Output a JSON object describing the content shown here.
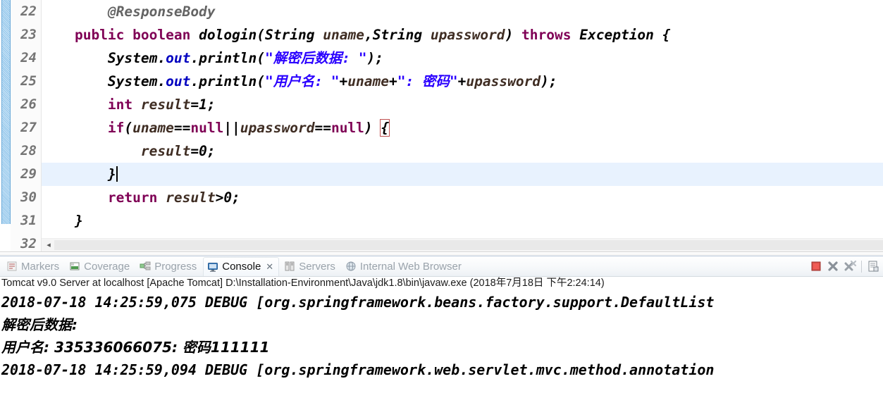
{
  "editor": {
    "lines": [
      {
        "number": "22",
        "tokens": [
          {
            "t": "        ",
            "c": "punc"
          },
          {
            "t": "@ResponseBody",
            "c": "ann"
          }
        ]
      },
      {
        "number": "23",
        "tokens": [
          {
            "t": "    ",
            "c": "punc"
          },
          {
            "t": "public",
            "c": "kw"
          },
          {
            "t": " ",
            "c": "punc"
          },
          {
            "t": "boolean",
            "c": "kw"
          },
          {
            "t": " ",
            "c": "punc"
          },
          {
            "t": "dologin(",
            "c": "mth"
          },
          {
            "t": "String",
            "c": "type"
          },
          {
            "t": " ",
            "c": "punc"
          },
          {
            "t": "uname",
            "c": "var"
          },
          {
            "t": ",",
            "c": "plain"
          },
          {
            "t": "String",
            "c": "type"
          },
          {
            "t": " ",
            "c": "punc"
          },
          {
            "t": "upassword",
            "c": "var"
          },
          {
            "t": ") ",
            "c": "plain"
          },
          {
            "t": "throws",
            "c": "kw"
          },
          {
            "t": " ",
            "c": "punc"
          },
          {
            "t": "Exception {",
            "c": "type"
          }
        ]
      },
      {
        "number": "24",
        "tokens": [
          {
            "t": "        ",
            "c": "punc"
          },
          {
            "t": "System",
            "c": "plain"
          },
          {
            "t": ".",
            "c": "plain"
          },
          {
            "t": "out",
            "c": "fld"
          },
          {
            "t": ".println(",
            "c": "plain"
          },
          {
            "t": "\"解密后数据: \"",
            "c": "str"
          },
          {
            "t": ");",
            "c": "plain"
          }
        ]
      },
      {
        "number": "25",
        "tokens": [
          {
            "t": "        ",
            "c": "punc"
          },
          {
            "t": "System",
            "c": "plain"
          },
          {
            "t": ".",
            "c": "plain"
          },
          {
            "t": "out",
            "c": "fld"
          },
          {
            "t": ".println(",
            "c": "plain"
          },
          {
            "t": "\"用户名: \"",
            "c": "str"
          },
          {
            "t": "+",
            "c": "plain"
          },
          {
            "t": "uname",
            "c": "var"
          },
          {
            "t": "+",
            "c": "plain"
          },
          {
            "t": "\": 密码\"",
            "c": "str"
          },
          {
            "t": "+",
            "c": "plain"
          },
          {
            "t": "upassword",
            "c": "var"
          },
          {
            "t": ");",
            "c": "plain"
          }
        ]
      },
      {
        "number": "26",
        "tokens": [
          {
            "t": "        ",
            "c": "punc"
          },
          {
            "t": "int",
            "c": "kw"
          },
          {
            "t": " ",
            "c": "punc"
          },
          {
            "t": "result",
            "c": "var"
          },
          {
            "t": "=1;",
            "c": "plain"
          }
        ]
      },
      {
        "number": "27",
        "tokens": [
          {
            "t": "        ",
            "c": "punc"
          },
          {
            "t": "if",
            "c": "kw"
          },
          {
            "t": "(",
            "c": "plain"
          },
          {
            "t": "uname",
            "c": "var"
          },
          {
            "t": "==",
            "c": "plain"
          },
          {
            "t": "null",
            "c": "kw"
          },
          {
            "t": "||",
            "c": "plain"
          },
          {
            "t": "upassword",
            "c": "var"
          },
          {
            "t": "==",
            "c": "plain"
          },
          {
            "t": "null",
            "c": "kw"
          },
          {
            "t": ") ",
            "c": "plain"
          },
          {
            "t": "{",
            "c": "brace"
          }
        ]
      },
      {
        "number": "28",
        "tokens": [
          {
            "t": "            ",
            "c": "punc"
          },
          {
            "t": "result",
            "c": "var"
          },
          {
            "t": "=0;",
            "c": "plain"
          }
        ]
      },
      {
        "number": "29",
        "highlight": true,
        "caret": true,
        "tokens": [
          {
            "t": "        ",
            "c": "punc"
          },
          {
            "t": "}",
            "c": "plain"
          }
        ]
      },
      {
        "number": "30",
        "tokens": [
          {
            "t": "        ",
            "c": "punc"
          },
          {
            "t": "return",
            "c": "kw"
          },
          {
            "t": " ",
            "c": "punc"
          },
          {
            "t": "result",
            "c": "var"
          },
          {
            "t": ">0;",
            "c": "plain"
          }
        ]
      },
      {
        "number": "31",
        "tokens": [
          {
            "t": "    ",
            "c": "punc"
          },
          {
            "t": "}",
            "c": "plain"
          }
        ]
      },
      {
        "number": "32",
        "tokens": []
      }
    ],
    "scroll_left_arrow": "◂"
  },
  "tabbar": {
    "tabs": [
      {
        "label": "Markers",
        "icon": "markers-icon",
        "active": false,
        "closable": false
      },
      {
        "label": "Coverage",
        "icon": "coverage-icon",
        "active": false,
        "closable": false
      },
      {
        "label": "Progress",
        "icon": "progress-icon",
        "active": false,
        "closable": false
      },
      {
        "label": "Console",
        "icon": "console-icon",
        "active": true,
        "closable": true
      },
      {
        "label": "Servers",
        "icon": "servers-icon",
        "active": false,
        "closable": false
      },
      {
        "label": "Internal Web Browser",
        "icon": "browser-icon",
        "active": false,
        "closable": false
      }
    ],
    "close_glyph": "✕",
    "toolbar": [
      {
        "name": "terminate-button",
        "title": "Terminate"
      },
      {
        "name": "remove-launch-button",
        "title": "Remove Launch"
      },
      {
        "name": "remove-all-terminated-button",
        "title": "Remove All Terminated Launches"
      },
      {
        "name": "open-console-button",
        "title": "Open Console"
      }
    ]
  },
  "console": {
    "header": "Tomcat v9.0 Server at localhost [Apache Tomcat] D:\\Installation-Environment\\Java\\jdk1.8\\bin\\javaw.exe (2018年7月18日 下午2:24:14)",
    "lines": [
      {
        "text": "2018-07-18 14:25:59,075 DEBUG [org.springframework.beans.factory.support.DefaultList",
        "cjk": false
      },
      {
        "text": "解密后数据: ",
        "cjk": true
      },
      {
        "text": "用户名: 335336066075: 密码111111",
        "cjk": true
      },
      {
        "text": "2018-07-18 14:25:59,094 DEBUG [org.springframework.web.servlet.mvc.method.annotation",
        "cjk": false
      }
    ]
  },
  "colors": {
    "keyword": "#7F0055",
    "string": "#2A00FF",
    "annotation": "#646464",
    "field": "#0000C0",
    "local_variable": "#3F2D23",
    "line_highlight": "#E8F2FE",
    "line_number": "#757575"
  }
}
